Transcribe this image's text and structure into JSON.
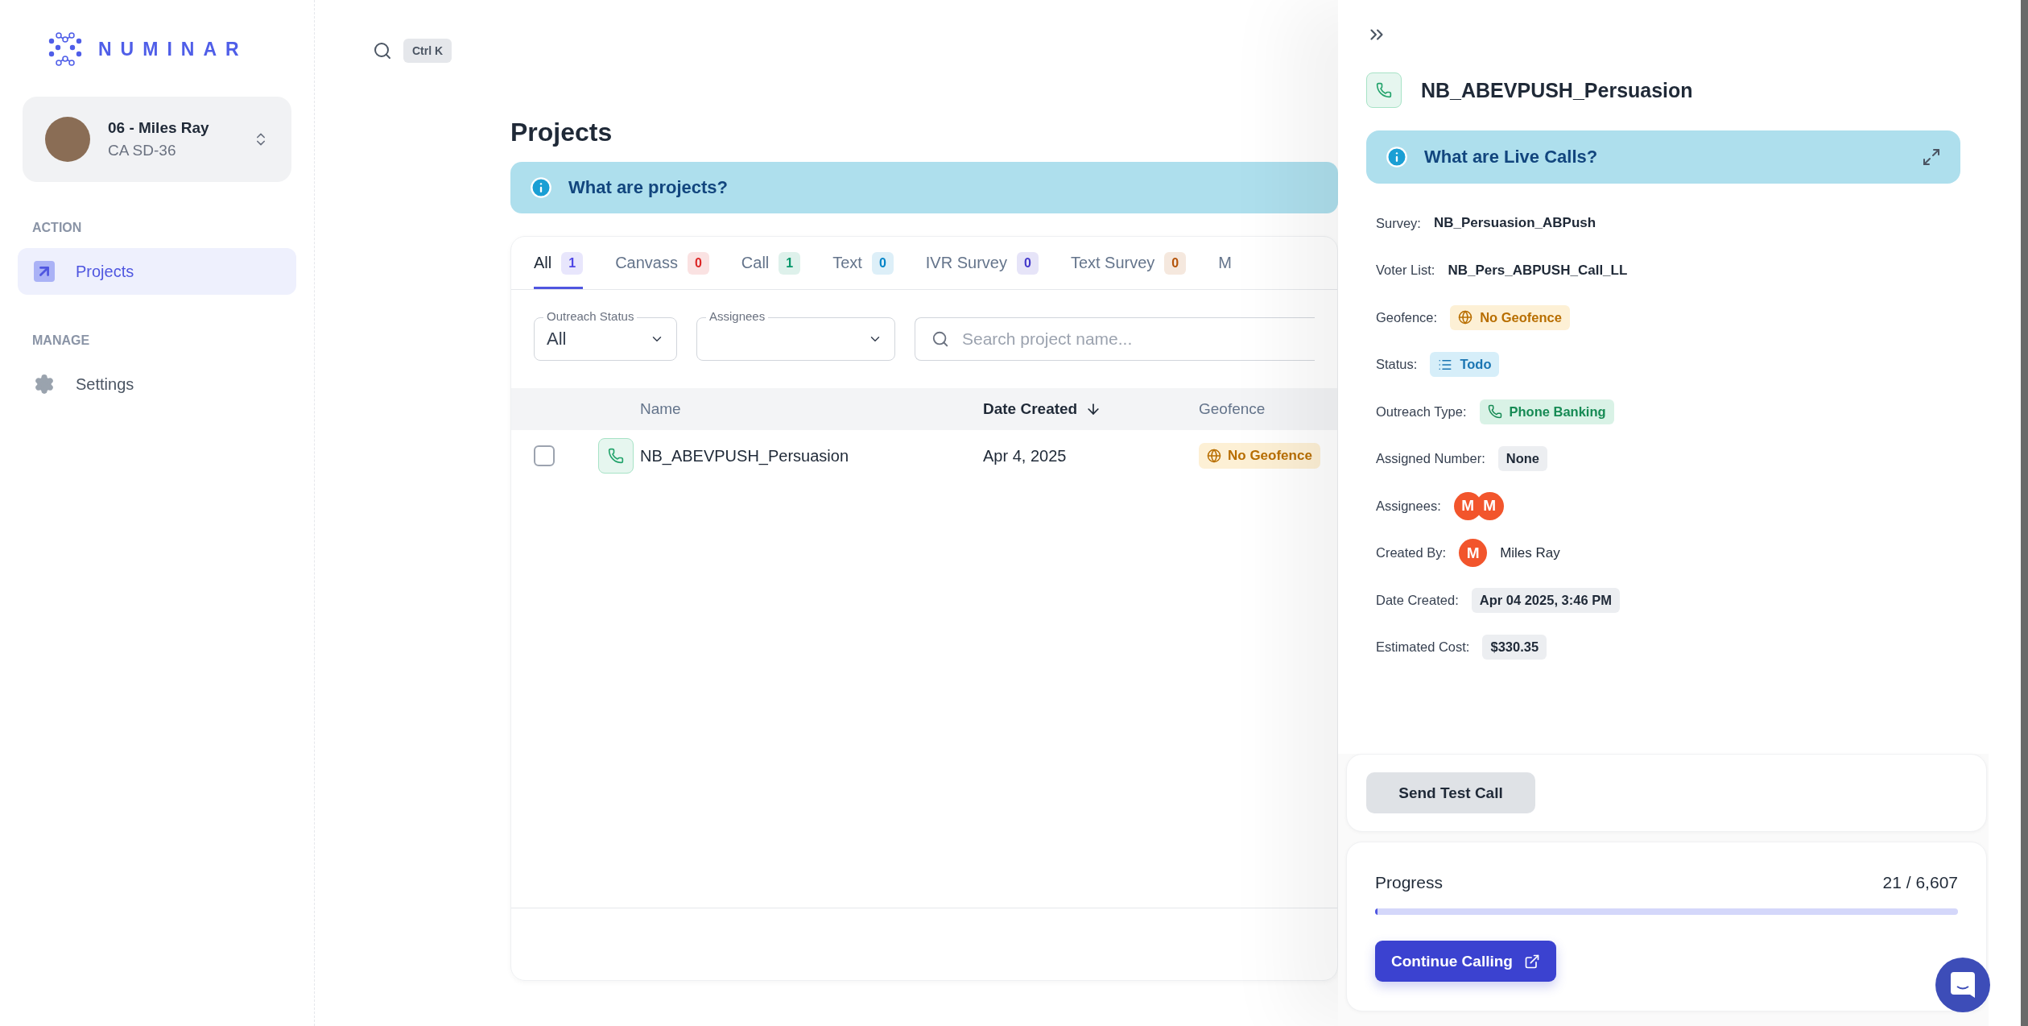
{
  "sidebar": {
    "logo": "NUMINAR",
    "account": {
      "name": "06 - Miles Ray",
      "district": "CA SD-36"
    },
    "sections": [
      {
        "title": "ACTION",
        "items": [
          {
            "label": "Projects",
            "selected": true
          }
        ]
      },
      {
        "title": "MANAGE",
        "items": [
          {
            "label": "Settings",
            "selected": false
          }
        ]
      }
    ]
  },
  "topbar": {
    "shortcut": "Ctrl K"
  },
  "page": {
    "title": "Projects",
    "info_banner": "What are projects?",
    "tabs": [
      {
        "label": "All",
        "count": "1",
        "color": "#4f46e5",
        "selected": true
      },
      {
        "label": "Canvass",
        "count": "0",
        "color": "#dc2626",
        "selected": false
      },
      {
        "label": "Call",
        "count": "1",
        "color": "#059669",
        "selected": false
      },
      {
        "label": "Text",
        "count": "0",
        "color": "#0284c7",
        "selected": false
      },
      {
        "label": "IVR Survey",
        "count": "0",
        "color": "#4338ca",
        "selected": false
      },
      {
        "label": "Text Survey",
        "count": "0",
        "color": "#b45309",
        "selected": false
      },
      {
        "label": "M",
        "selected": false
      }
    ],
    "filters": {
      "outreach_status": {
        "label": "Outreach Status",
        "value": "All"
      },
      "assignees": {
        "label": "Assignees"
      },
      "search": {
        "placeholder": "Search project name..."
      }
    },
    "table": {
      "columns": [
        "Name",
        "Date Created",
        "Geofence"
      ],
      "rows": [
        {
          "checked": false,
          "name": "NB_ABEVPUSH_Persuasion",
          "date": "Apr 4, 2025",
          "geofence": "No Geofence"
        }
      ]
    }
  },
  "panel": {
    "title": "NB_ABEVPUSH_Persuasion",
    "info_banner": "What are Live Calls?",
    "fields": [
      {
        "label": "Survey:",
        "kind": "text",
        "value": "NB_Persuasion_ABPush"
      },
      {
        "label": "Voter List:",
        "kind": "text",
        "value": "NB_Pers_ABPUSH_Call_LL"
      },
      {
        "label": "Geofence:",
        "kind": "geofence",
        "value": "No Geofence"
      },
      {
        "label": "Status:",
        "kind": "status",
        "value": "Todo"
      },
      {
        "label": "Outreach Type:",
        "kind": "outreach",
        "value": "Phone Banking"
      },
      {
        "label": "Assigned Number:",
        "kind": "chip",
        "value": "None"
      },
      {
        "label": "Assignees:",
        "kind": "avatars",
        "initials": [
          "M",
          "M"
        ]
      },
      {
        "label": "Created By:",
        "kind": "user",
        "initials": "M",
        "value": "Miles Ray"
      },
      {
        "label": "Date Created:",
        "kind": "chip",
        "value": "Apr 04 2025, 3:46 PM"
      },
      {
        "label": "Estimated Cost:",
        "kind": "chip",
        "value": "$330.35"
      }
    ],
    "test_button": "Send Test Call",
    "progress": {
      "label": "Progress",
      "reading": "21 / 6,607",
      "level": 0.003
    },
    "continue_button": "Continue Calling"
  }
}
